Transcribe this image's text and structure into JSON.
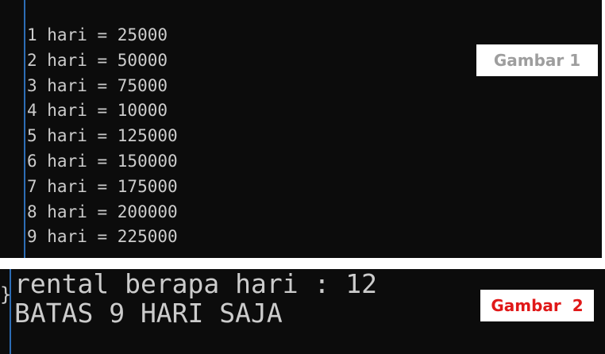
{
  "gambar1": {
    "lines": [
      "1 hari = 25000",
      "2 hari = 50000",
      "3 hari = 75000",
      "4 hari = 10000",
      "5 hari = 125000",
      "6 hari = 150000",
      "7 hari = 175000",
      "8 hari = 200000",
      "9 hari = 225000"
    ],
    "label": "Gambar 1",
    "label_color": "#9e9e9e"
  },
  "gambar2": {
    "lines": [
      "rental berapa hari : 12",
      "BATAS 9 HARI SAJA"
    ],
    "brace": "}",
    "label": "Gambar  2",
    "label_color": "#e01818"
  },
  "colors": {
    "console_background": "#0c0c0c",
    "console_text": "#cccccc",
    "cursor_line": "#2d6db5"
  }
}
